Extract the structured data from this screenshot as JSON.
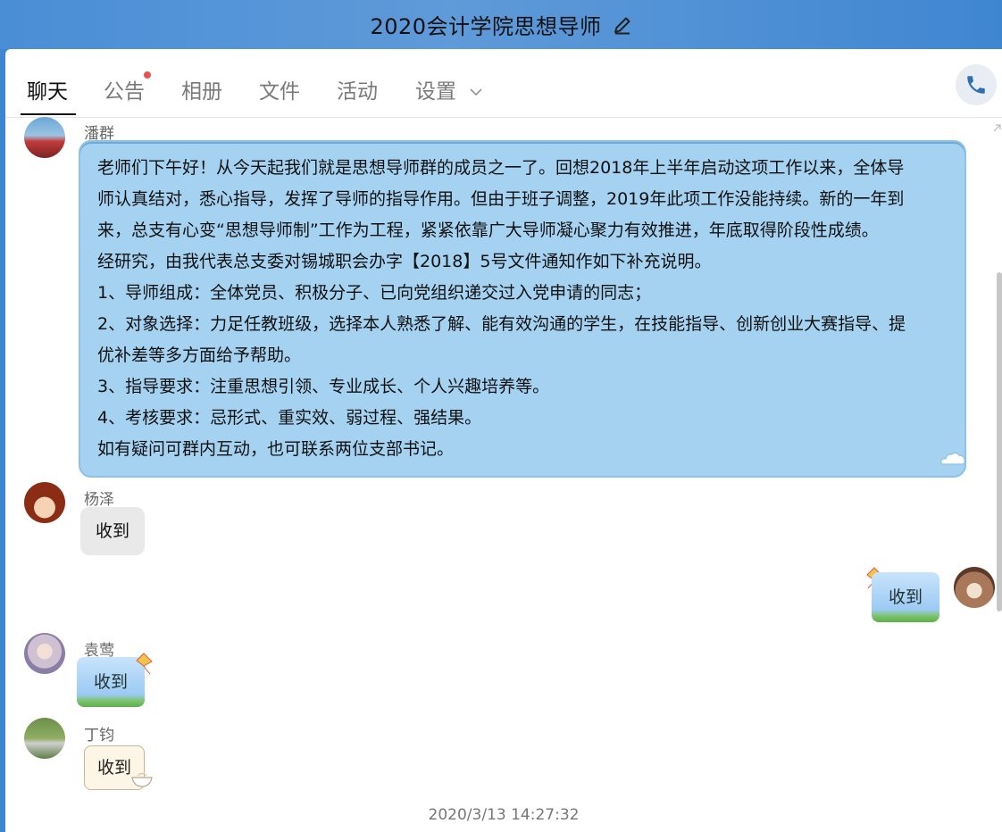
{
  "window": {
    "title": "2020会计学院思想导师"
  },
  "tabs": [
    {
      "label": "聊天"
    },
    {
      "label": "公告"
    },
    {
      "label": "相册"
    },
    {
      "label": "文件"
    },
    {
      "label": "活动"
    },
    {
      "label": "设置"
    }
  ],
  "messages": [
    {
      "sender": "潘群",
      "lines": [
        "老师们下午好！从今天起我们就是思想导师群的成员之一了。回想2018年上半年启动这项工作以来，全体导",
        "师认真结对，悉心指导，发挥了导师的指导作用。但由于班子调整，2019年此项工作没能持续。新的一年到",
        "来，总支有心变“思想导师制”工作为工程，紧紧依靠广大导师凝心聚力有效推进，年底取得阶段性成绩。",
        "经研究，由我代表总支委对锡城职会办字【2018】5号文件通知作如下补充说明。",
        "1、导师组成：全体党员、积极分子、已向党组织递交过入党申请的同志；",
        "2、对象选择：力足任教班级，选择本人熟悉了解、能有效沟通的学生，在技能指导、创新创业大赛指导、提",
        "优补差等多方面给予帮助。",
        "3、指导要求：注重思想引领、专业成长、个人兴趣培养等。",
        "4、考核要求：忌形式、重实效、弱过程、强结果。",
        "如有疑问可群内互动，也可联系两位支部书记。"
      ]
    },
    {
      "sender": "杨泽",
      "text": "收到"
    },
    {
      "sender": "",
      "text": "收到"
    },
    {
      "sender": "袁莺",
      "text": "收到"
    },
    {
      "sender": "丁钧",
      "text": "收到"
    }
  ],
  "timestamp": "2020/3/13 14:27:32",
  "colors": {
    "titlebar": "#4a8ed6",
    "bubble_blue": "#a6d2f2",
    "notice_dot": "#e7524f"
  }
}
